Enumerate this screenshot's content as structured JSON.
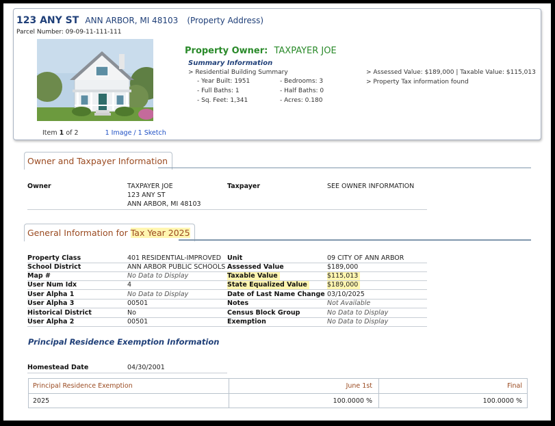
{
  "property": {
    "street": "123 ANY ST",
    "city_state_zip": "ANN ARBOR, MI 48103",
    "address_label": "(Property Address)",
    "parcel_number": "Parcel Number: 09-09-11-111-111",
    "owner_label": "Property Owner:",
    "owner_name": "TAXPAYER JOE"
  },
  "gallery": {
    "item_prefix": "Item",
    "item_index": "1",
    "item_of": "of 2",
    "links": "1 Image / 1 Sketch"
  },
  "summary": {
    "title": "Summary Information",
    "building_summary": "> Residential Building Summary",
    "year_built": "- Year Built: 1951",
    "bedrooms": "- Bedrooms: 3",
    "full_baths": "- Full Baths: 1",
    "half_baths": "- Half Baths: 0",
    "sq_feet": "- Sq. Feet: 1,341",
    "acres": "- Acres: 0.180",
    "assessed_line": "> Assessed Value: $189,000 | Taxable Value: $115,013",
    "tax_line": "> Property Tax information found"
  },
  "owner_section": {
    "tab": "Owner and Taxpayer Information",
    "owner_label": "Owner",
    "owner_line1": "TAXPAYER JOE",
    "owner_line2": "123 ANY ST",
    "owner_line3": "ANN ARBOR, MI 48103",
    "taxpayer_label": "Taxpayer",
    "taxpayer_value": "SEE OWNER INFORMATION"
  },
  "general_section": {
    "tab_prefix": "General Information for ",
    "tab_highlight": "Tax Year 2025",
    "rows": [
      {
        "l1": "Property Class",
        "v1": "401 RESIDENTIAL-IMPROVED",
        "l2": "Unit",
        "v2": "09 CITY OF ANN ARBOR"
      },
      {
        "l1": "School District",
        "v1": "ANN ARBOR PUBLIC SCHOOLS",
        "l2": "Assessed Value",
        "v2": "$189,000"
      },
      {
        "l1": "Map #",
        "v1": "No Data to Display",
        "l2": "Taxable Value",
        "v2": "$115,013"
      },
      {
        "l1": "User Num Idx",
        "v1": "4",
        "l2": "State Equalized Value",
        "v2": "$189,000"
      },
      {
        "l1": "User Alpha 1",
        "v1": "No Data to Display",
        "l2": "Date of Last Name Change",
        "v2": "03/10/2025"
      },
      {
        "l1": "User Alpha 3",
        "v1": "00501",
        "l2": "Notes",
        "v2": "Not Available"
      },
      {
        "l1": "Historical District",
        "v1": "No",
        "l2": "Census Block Group",
        "v2": "No Data to Display"
      },
      {
        "l1": "User Alpha 2",
        "v1": "00501",
        "l2": "Exemption",
        "v2": "No Data to Display"
      }
    ]
  },
  "pre_section": {
    "title": "Principal Residence Exemption Information",
    "homestead_label": "Homestead Date",
    "homestead_value": "04/30/2001",
    "col1": "Principal Residence Exemption",
    "col2": "June 1st",
    "col3": "Final",
    "year": "2025",
    "june_value": "100.0000 %",
    "final_value": "100.0000 %"
  },
  "colors": {
    "address_blue": "#1f3f78",
    "owner_green": "#2a8a2a",
    "tab_brown": "#9a4a20",
    "highlight_yellow": "#fff6b0",
    "link_blue": "#1d4fc4"
  }
}
